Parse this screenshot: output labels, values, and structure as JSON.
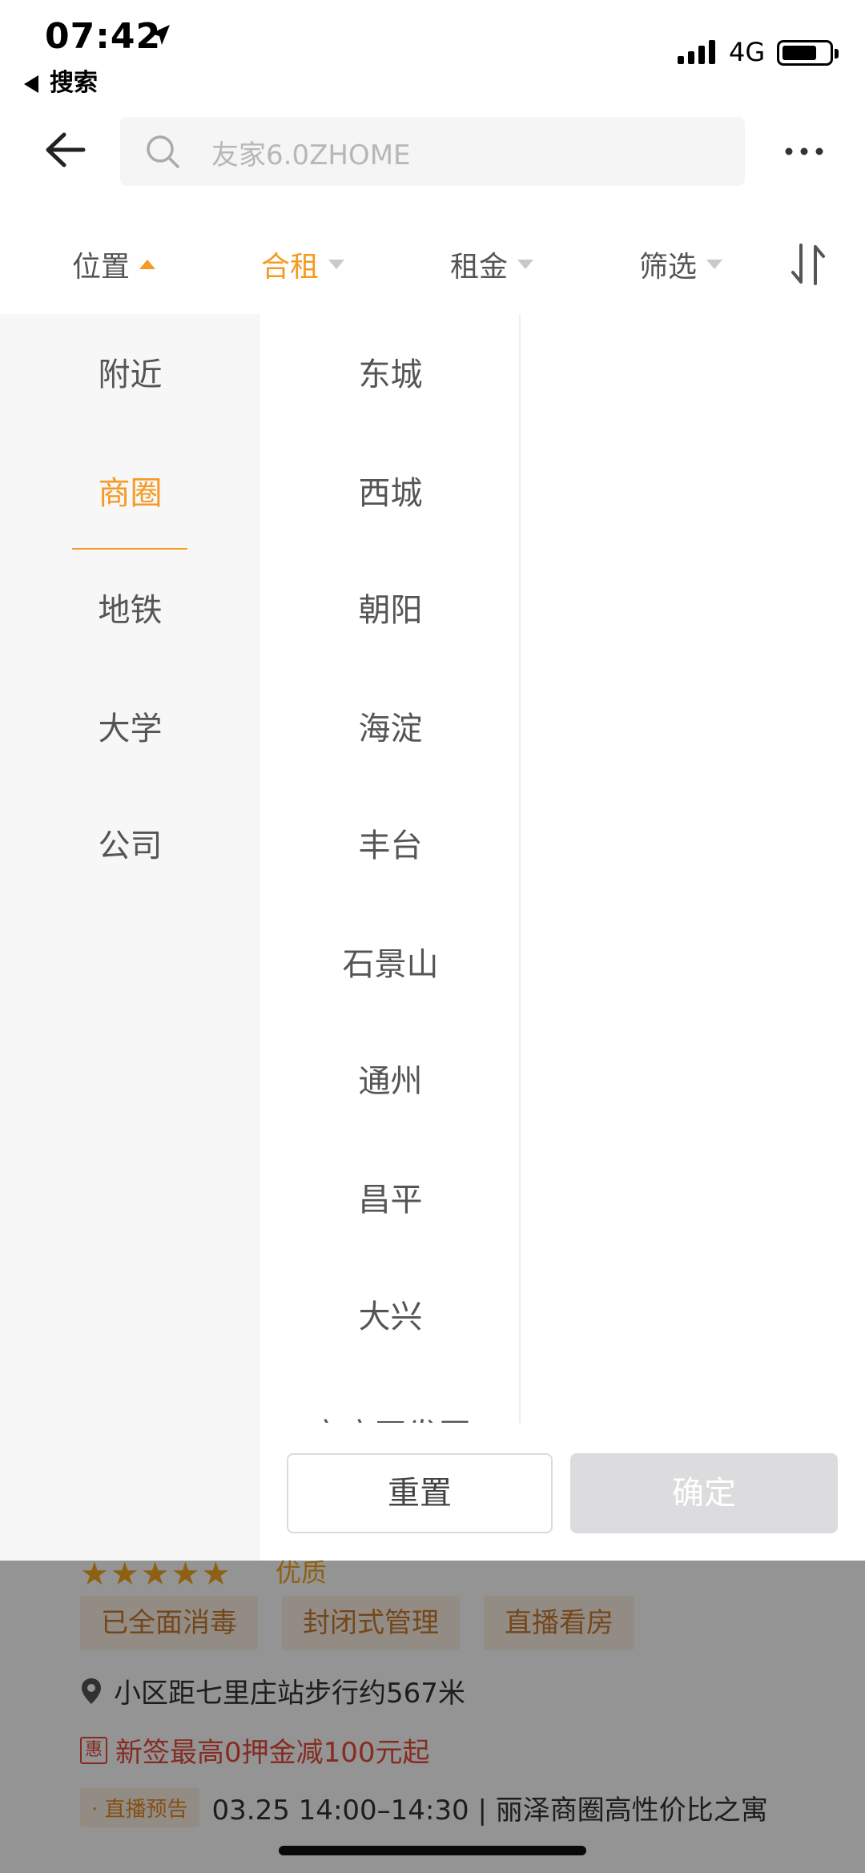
{
  "status_bar": {
    "time": "07:42",
    "back_app": "搜索",
    "network": "4G"
  },
  "search": {
    "placeholder": "友家6.0ZHOME"
  },
  "tabs": [
    {
      "label": "位置"
    },
    {
      "label": "合租"
    },
    {
      "label": "租金"
    },
    {
      "label": "筛选"
    }
  ],
  "location_types": [
    "附近",
    "商圈",
    "地铁",
    "大学",
    "公司"
  ],
  "active_location_type": "商圈",
  "districts": [
    "东城",
    "西城",
    "朝阳",
    "海淀",
    "丰台",
    "石景山",
    "通州",
    "昌平",
    "大兴",
    "亦庄开发区"
  ],
  "buttons": {
    "reset": "重置",
    "confirm": "确定"
  },
  "listing": {
    "rating_label": "优质",
    "tags": [
      "已全面消毒",
      "封闭式管理",
      "直播看房"
    ],
    "location_note": "小区距七里庄站步行约567米",
    "promo_icon": "惠",
    "promo": "新签最高0押金减100元起",
    "live_badge": "· 直播预告",
    "live_text": "03.25 14:00–14:30 | 丽泽商圈高性价比之寓"
  },
  "colors": {
    "accent": "#f59a23",
    "promo": "#e54b3c"
  }
}
